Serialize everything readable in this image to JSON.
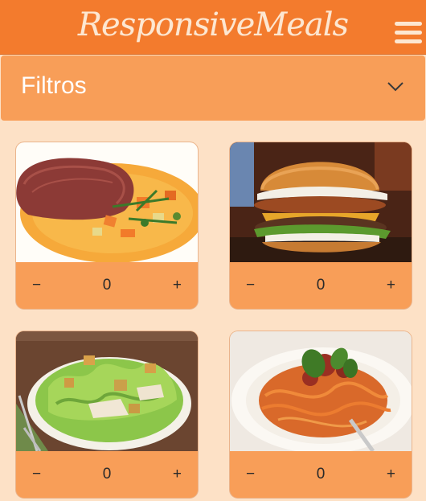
{
  "header": {
    "brand": "ResponsiveMeals",
    "menu_icon": "hamburger-icon"
  },
  "filters": {
    "label": "Filtros",
    "icon": "chevron-down-icon"
  },
  "cards": [
    {
      "image": "steak-with-vegetables",
      "minus": "−",
      "quantity": "0",
      "plus": "+"
    },
    {
      "image": "burger",
      "minus": "−",
      "quantity": "0",
      "plus": "+"
    },
    {
      "image": "caesar-salad",
      "minus": "−",
      "quantity": "0",
      "plus": "+"
    },
    {
      "image": "spaghetti-bolognese",
      "minus": "−",
      "quantity": "0",
      "plus": "+"
    }
  ],
  "colors": {
    "header": "#f37b2d",
    "panel": "#f89e58",
    "background": "#fde1c6",
    "brand_text": "#fde7d1"
  }
}
